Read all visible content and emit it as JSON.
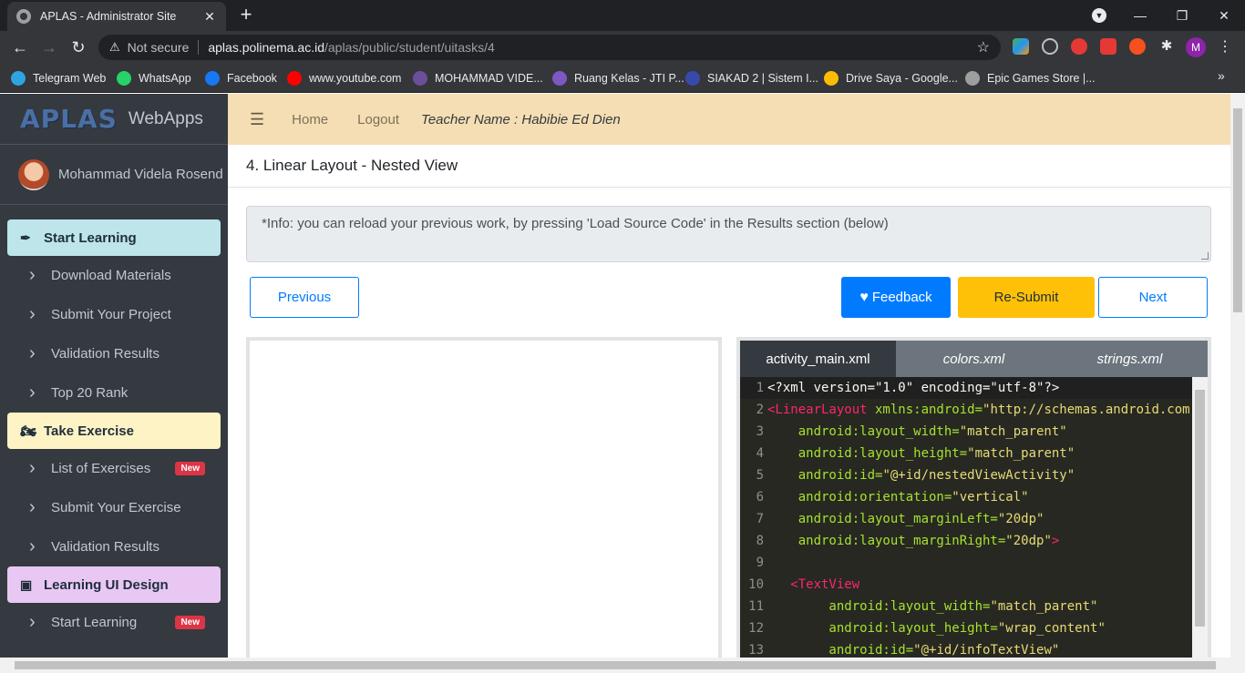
{
  "browser": {
    "tab_title": "APLAS - Administrator Site",
    "security_label": "Not secure",
    "url_host": "aplas.polinema.ac.id",
    "url_path": "/aplas/public/student/uitasks/4",
    "avatar_letter": "M",
    "bookmarks": [
      {
        "label": "Telegram Web",
        "color": "#2ca5e0"
      },
      {
        "label": "WhatsApp",
        "color": "#25d366"
      },
      {
        "label": "Facebook",
        "color": "#1877f2"
      },
      {
        "label": "www.youtube.com",
        "color": "#ff0000"
      },
      {
        "label": "MOHAMMAD VIDE...",
        "color": "#6b4f9a"
      },
      {
        "label": "Ruang Kelas - JTI P...",
        "color": "#7e57c2"
      },
      {
        "label": "SIAKAD 2 | Sistem I...",
        "color": "#3949ab"
      },
      {
        "label": "Drive Saya - Google...",
        "color": "#fbbc04"
      },
      {
        "label": "Epic Games Store |...",
        "color": "#9e9e9e"
      }
    ]
  },
  "sidebar": {
    "brand_logo": "APLAS",
    "brand_text": "WebApps",
    "user_name": "Mohammad Videla Rosend",
    "sections": [
      {
        "title": "Start Learning",
        "icon": "pen-icon",
        "color": "#bde5ea",
        "items": [
          {
            "label": "Download Materials",
            "badge": ""
          },
          {
            "label": "Submit Your Project",
            "badge": ""
          },
          {
            "label": "Validation Results",
            "badge": ""
          },
          {
            "label": "Top 20 Rank",
            "badge": ""
          }
        ]
      },
      {
        "title": "Take Exercise",
        "icon": "motorcycle-icon",
        "color": "#fdf3c4",
        "items": [
          {
            "label": "List of Exercises",
            "badge": "New"
          },
          {
            "label": "Submit Your Exercise",
            "badge": ""
          },
          {
            "label": "Validation Results",
            "badge": ""
          }
        ]
      },
      {
        "title": "Learning UI Design",
        "icon": "image-icon",
        "color": "#e8c8f3",
        "items": [
          {
            "label": "Start Learning",
            "badge": "New"
          }
        ]
      }
    ]
  },
  "topnav": {
    "home": "Home",
    "logout": "Logout",
    "teacher": "Teacher Name : Habibie Ed Dien"
  },
  "main": {
    "task_title": "4. Linear Layout - Nested View",
    "info": "*Info: you can reload your previous work, by pressing 'Load Source Code' in the Results section (below)",
    "buttons": {
      "previous": "Previous",
      "feedback": "Feedback",
      "resubmit": "Re-Submit",
      "next": "Next"
    }
  },
  "editor": {
    "tabs": [
      "activity_main.xml",
      "colors.xml",
      "strings.xml"
    ],
    "lines": [
      {
        "n": "1",
        "parts": [
          {
            "t": "plain",
            "v": "<?xml version=\"1.0\" encoding=\"utf-8\"?>"
          }
        ]
      },
      {
        "n": "2",
        "parts": [
          {
            "t": "tag",
            "v": "<LinearLayout"
          },
          {
            "t": "attr",
            "v": " xmlns:android="
          },
          {
            "t": "str",
            "v": "\"http://schemas.android.com"
          }
        ]
      },
      {
        "n": "3",
        "parts": [
          {
            "t": "attr",
            "v": "    android:layout_width="
          },
          {
            "t": "str",
            "v": "\"match_parent\""
          }
        ]
      },
      {
        "n": "4",
        "parts": [
          {
            "t": "attr",
            "v": "    android:layout_height="
          },
          {
            "t": "str",
            "v": "\"match_parent\""
          }
        ]
      },
      {
        "n": "5",
        "parts": [
          {
            "t": "attr",
            "v": "    android:id="
          },
          {
            "t": "str",
            "v": "\"@+id/nestedViewActivity\""
          }
        ]
      },
      {
        "n": "6",
        "parts": [
          {
            "t": "attr",
            "v": "    android:orientation="
          },
          {
            "t": "str",
            "v": "\"vertical\""
          }
        ]
      },
      {
        "n": "7",
        "parts": [
          {
            "t": "attr",
            "v": "    android:layout_marginLeft="
          },
          {
            "t": "str",
            "v": "\"20dp\""
          }
        ]
      },
      {
        "n": "8",
        "parts": [
          {
            "t": "attr",
            "v": "    android:layout_marginRight="
          },
          {
            "t": "str",
            "v": "\"20dp\""
          },
          {
            "t": "tag",
            "v": ">"
          }
        ]
      },
      {
        "n": "9",
        "parts": []
      },
      {
        "n": "10",
        "parts": [
          {
            "t": "tag",
            "v": "   <TextView"
          }
        ]
      },
      {
        "n": "11",
        "parts": [
          {
            "t": "attr",
            "v": "        android:layout_width="
          },
          {
            "t": "str",
            "v": "\"match_parent\""
          }
        ]
      },
      {
        "n": "12",
        "parts": [
          {
            "t": "attr",
            "v": "        android:layout_height="
          },
          {
            "t": "str",
            "v": "\"wrap_content\""
          }
        ]
      },
      {
        "n": "13",
        "parts": [
          {
            "t": "attr",
            "v": "        android:id="
          },
          {
            "t": "str",
            "v": "\"@+id/infoTextView\""
          }
        ]
      }
    ]
  }
}
